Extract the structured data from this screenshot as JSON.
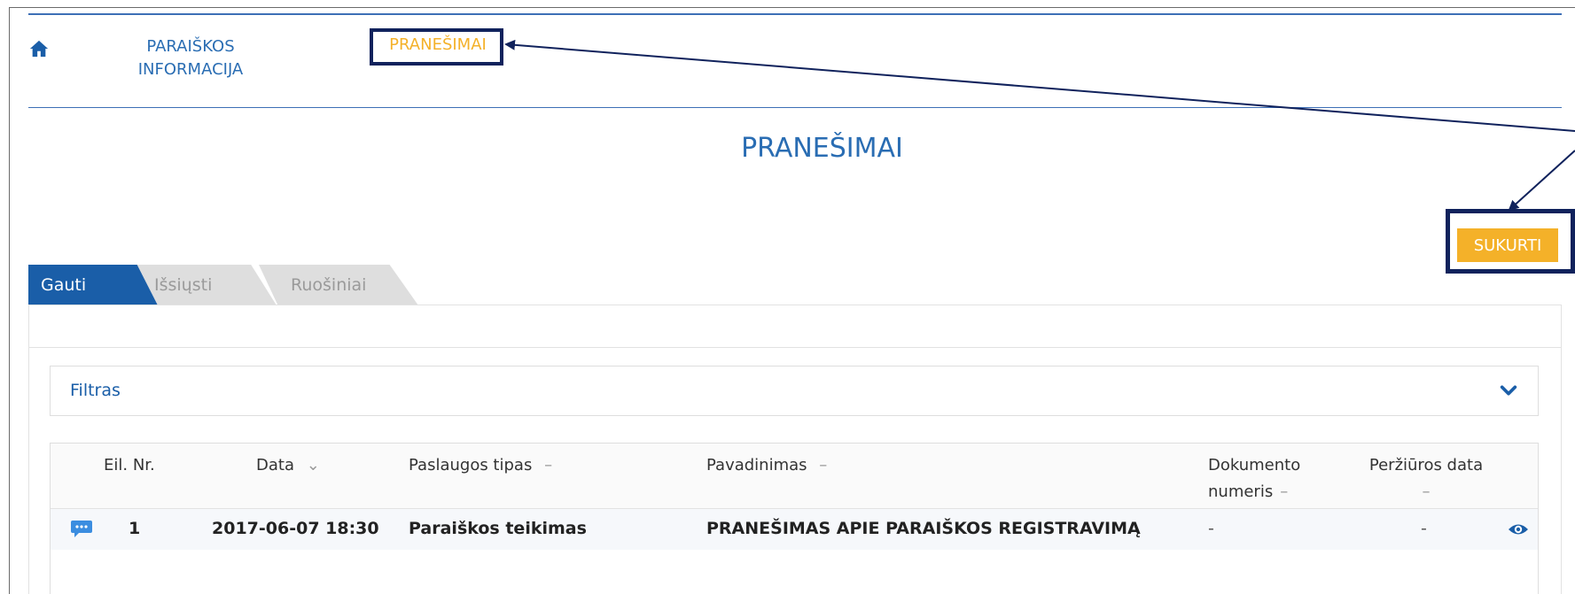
{
  "nav": {
    "info_line1": "PARAIŠKOS",
    "info_line2": "INFORMACIJA",
    "messages": "PRANEŠIMAI"
  },
  "page": {
    "title": "PRANEŠIMAI",
    "create_button": "SUKURTI"
  },
  "tabs": [
    {
      "label": "Gauti",
      "active": true
    },
    {
      "label": "Išsiųsti",
      "active": false
    },
    {
      "label": "Ruošiniai",
      "active": false
    }
  ],
  "filter": {
    "label": "Filtras"
  },
  "table": {
    "headers": {
      "nr": "Eil. Nr.",
      "date": "Data",
      "service_type": "Paslaugos tipas",
      "name": "Pavadinimas",
      "doc_no_line1": "Dokumento",
      "doc_no_line2": "numeris",
      "view_date_line1": "Peržiūros data"
    },
    "rows": [
      {
        "nr": "1",
        "date": "2017-06-07 18:30",
        "service_type": "Paraiškos teikimas",
        "name": "PRANEŠIMAS APIE PARAIŠKOS REGISTRAVIMĄ",
        "doc_no": "-",
        "view_date": "-"
      }
    ]
  },
  "colors": {
    "primary_blue": "#1a5ea8",
    "accent_orange": "#f4b129",
    "highlight_navy": "#10225c"
  },
  "icons": {
    "home": "home-icon",
    "chevron": "chevron-down-icon",
    "message": "message-icon",
    "view": "eye-icon"
  }
}
